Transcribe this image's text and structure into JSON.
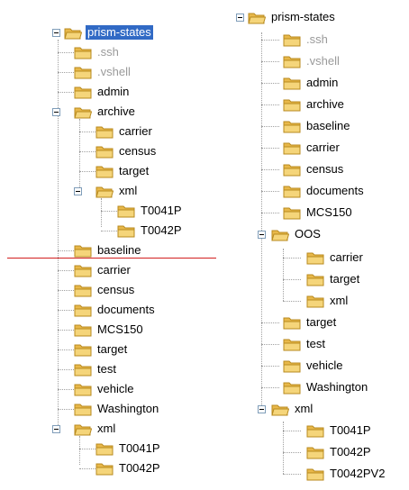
{
  "left_tree": {
    "root": "prism-states",
    "items": [
      {
        "label": ".ssh",
        "depth": 1,
        "hidden": true
      },
      {
        "label": ".vshell",
        "depth": 1,
        "hidden": true
      },
      {
        "label": "admin",
        "depth": 1
      },
      {
        "label": "archive",
        "depth": 1,
        "expanded": true
      },
      {
        "label": "carrier",
        "depth": 2
      },
      {
        "label": "census",
        "depth": 2
      },
      {
        "label": "target",
        "depth": 2
      },
      {
        "label": "xml",
        "depth": 2,
        "expanded": true
      },
      {
        "label": "T0041P",
        "depth": 3
      },
      {
        "label": "T0042P",
        "depth": 3
      },
      {
        "label": "baseline",
        "depth": 1
      },
      {
        "label": "carrier",
        "depth": 1
      },
      {
        "label": "census",
        "depth": 1
      },
      {
        "label": "documents",
        "depth": 1
      },
      {
        "label": "MCS150",
        "depth": 1
      },
      {
        "label": "target",
        "depth": 1
      },
      {
        "label": "test",
        "depth": 1
      },
      {
        "label": "vehicle",
        "depth": 1
      },
      {
        "label": "Washington",
        "depth": 1
      },
      {
        "label": "xml",
        "depth": 1,
        "expanded": true
      },
      {
        "label": "T0041P",
        "depth": 2
      },
      {
        "label": "T0042P",
        "depth": 2
      }
    ]
  },
  "right_tree": {
    "root": "prism-states",
    "items": [
      {
        "label": ".ssh",
        "depth": 1,
        "hidden": true
      },
      {
        "label": ".vshell",
        "depth": 1,
        "hidden": true
      },
      {
        "label": "admin",
        "depth": 1
      },
      {
        "label": "archive",
        "depth": 1
      },
      {
        "label": "baseline",
        "depth": 1
      },
      {
        "label": "carrier",
        "depth": 1
      },
      {
        "label": "census",
        "depth": 1
      },
      {
        "label": "documents",
        "depth": 1
      },
      {
        "label": "MCS150",
        "depth": 1
      },
      {
        "label": "OOS",
        "depth": 1,
        "expanded": true
      },
      {
        "label": "carrier",
        "depth": 2
      },
      {
        "label": "target",
        "depth": 2
      },
      {
        "label": "xml",
        "depth": 2
      },
      {
        "label": "target",
        "depth": 1
      },
      {
        "label": "test",
        "depth": 1
      },
      {
        "label": "vehicle",
        "depth": 1
      },
      {
        "label": "Washington",
        "depth": 1
      },
      {
        "label": "xml",
        "depth": 1,
        "expanded": true
      },
      {
        "label": "T0041P",
        "depth": 2
      },
      {
        "label": "T0042P",
        "depth": 2
      },
      {
        "label": "T0042PV2",
        "depth": 2
      }
    ]
  },
  "colors": {
    "folder_fill": "#f5d57a",
    "folder_tab": "#e8b84a",
    "folder_edge": "#b88a1f",
    "selection": "#316ac5",
    "divider": "#d21f1f"
  },
  "icons": {
    "folder": "folder-icon",
    "collapse": "collapse-toggle-icon"
  }
}
